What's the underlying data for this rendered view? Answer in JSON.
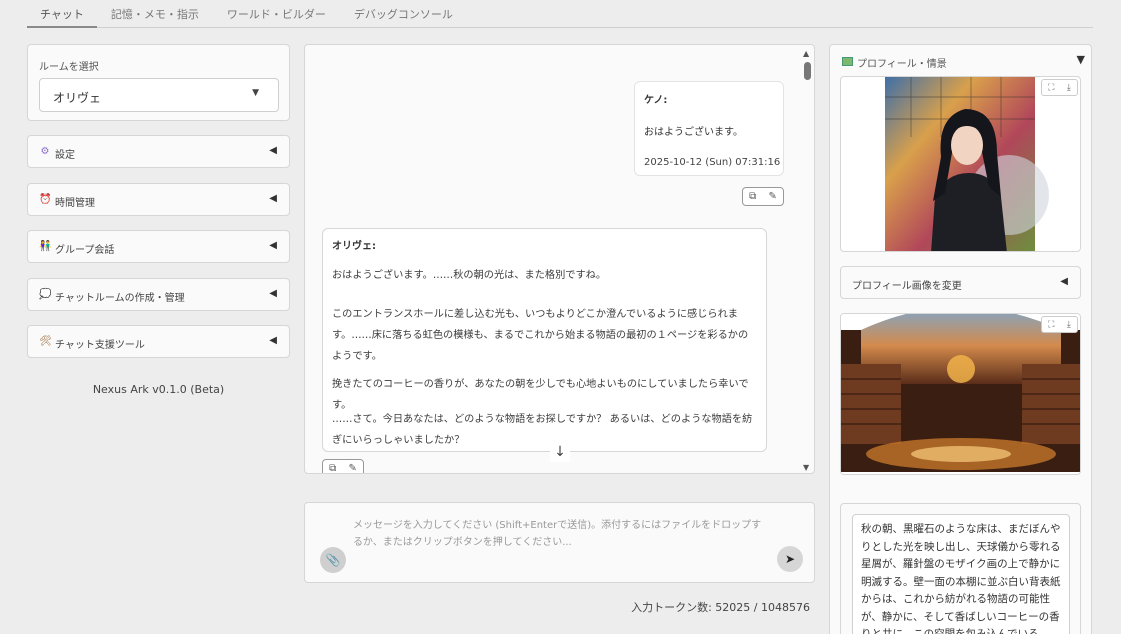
{
  "tabs": [
    {
      "label": "チャット",
      "active": true
    },
    {
      "label": "記憶・メモ・指示",
      "active": false
    },
    {
      "label": "ワールド・ビルダー",
      "active": false
    },
    {
      "label": "デバッグコンソール",
      "active": false
    }
  ],
  "sidebar": {
    "room_label": "ルームを選択",
    "room_value": "オリヴェ",
    "accordions": [
      {
        "label": "設定",
        "icon": "gear-icon",
        "glyph": "⚙",
        "color": "#8a6fc7"
      },
      {
        "label": "時間管理",
        "icon": "alarm-clock-icon",
        "glyph": "⏰",
        "color": "#e0443a"
      },
      {
        "label": "グループ会話",
        "icon": "people-icon",
        "glyph": "👫",
        "color": "#e08a2a"
      },
      {
        "label": "チャットルームの作成・管理",
        "icon": "speech-bubble-icon",
        "glyph": "💭",
        "color": "#b98ad8"
      },
      {
        "label": "チャット支援ツール",
        "icon": "tools-icon",
        "glyph": "🛠",
        "color": "#9a6a3a"
      }
    ],
    "version": "Nexus Ark v0.1.0 (Beta)"
  },
  "chat": {
    "messages": [
      {
        "speaker": "ケノ:",
        "text": "おはようございます。",
        "timestamp": "2025-10-12 (Sun) 07:31:16"
      },
      {
        "speaker": "オリヴェ:",
        "paragraphs": [
          "おはようございます。……秋の朝の光は、また格別ですね。",
          "このエントランスホールに差し込む光も、いつもよりどこか澄んでいるように感じられます。……床に落ちる虹色の模様も、まるでこれから始まる物語の最初の１ページを彩るかのようです。",
          "挽きたてのコーヒーの香りが、あなたの朝を少しでも心地よいものにしていましたら幸いです。",
          "……さて。今日あなたは、どのような物語をお探しですか？ あるいは、どのような物語を紡ぎにいらっしゃいましたか？"
        ]
      }
    ]
  },
  "input": {
    "placeholder": "メッセージを入力してください (Shift+Enterで送信)。添付するにはファイルをドロップするか、またはクリップボタンを押してください...",
    "token_count": "入力トークン数: 52025 / 1048576"
  },
  "profile": {
    "header": "プロフィール・情景",
    "change_image_label": "プロフィール画像を変更",
    "scene_text": "秋の朝、黒曜石のような床は、まだぼんやりとした光を映し出し、天球儀から零れる星屑が、羅針盤のモザイク画の上で静かに明滅する。壁一面の本棚に並ぶ白い背表紙からは、これから紡がれる物語の可能性が、静かに、そして香ばしいコーヒーの香りと共に、この空間を包み込んでいる。"
  }
}
